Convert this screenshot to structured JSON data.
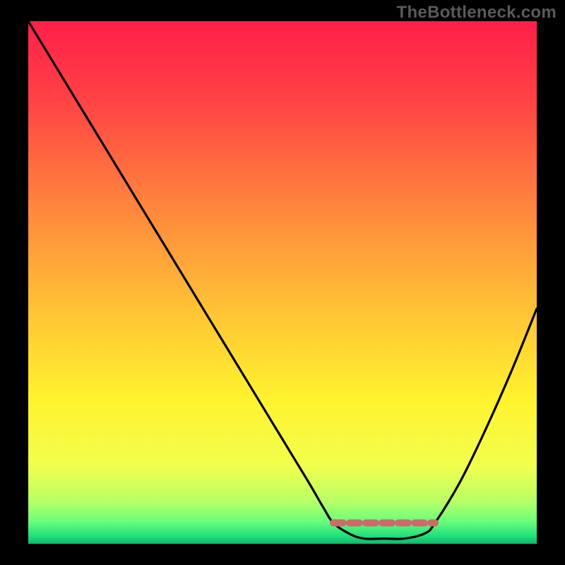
{
  "watermark": "TheBottleneck.com",
  "chart_data": {
    "type": "line",
    "title": "",
    "xlabel": "",
    "ylabel": "",
    "xlim": [
      0,
      100
    ],
    "ylim": [
      0,
      100
    ],
    "series": [
      {
        "name": "bottleneck-curve",
        "x": [
          0,
          5,
          10,
          15,
          20,
          25,
          30,
          35,
          40,
          45,
          50,
          55,
          58,
          60,
          63,
          66,
          70,
          74,
          78,
          80,
          85,
          90,
          95,
          100
        ],
        "values": [
          100,
          92,
          84,
          76,
          68,
          60,
          52,
          44,
          36,
          28,
          20,
          12,
          7,
          4,
          2,
          1,
          1,
          1,
          2,
          4,
          12,
          22,
          33,
          45
        ]
      },
      {
        "name": "sweet-spot-band",
        "x": [
          60,
          63,
          66,
          70,
          74,
          78,
          80
        ],
        "values": [
          4,
          4,
          4,
          4,
          4,
          4,
          4
        ]
      }
    ],
    "gradient_stops": [
      {
        "pos": 0.0,
        "color": "#ff1f4a"
      },
      {
        "pos": 0.15,
        "color": "#ff4245"
      },
      {
        "pos": 0.35,
        "color": "#ff843d"
      },
      {
        "pos": 0.55,
        "color": "#ffc236"
      },
      {
        "pos": 0.72,
        "color": "#fff22e"
      },
      {
        "pos": 0.85,
        "color": "#f2ff4d"
      },
      {
        "pos": 0.92,
        "color": "#b6ff66"
      },
      {
        "pos": 0.955,
        "color": "#6fff7a"
      },
      {
        "pos": 0.985,
        "color": "#22e07d"
      },
      {
        "pos": 1.0,
        "color": "#0fb66a"
      }
    ],
    "curve_color": "#000000",
    "band_color": "#cf6a6a",
    "legend": null,
    "grid": false
  }
}
